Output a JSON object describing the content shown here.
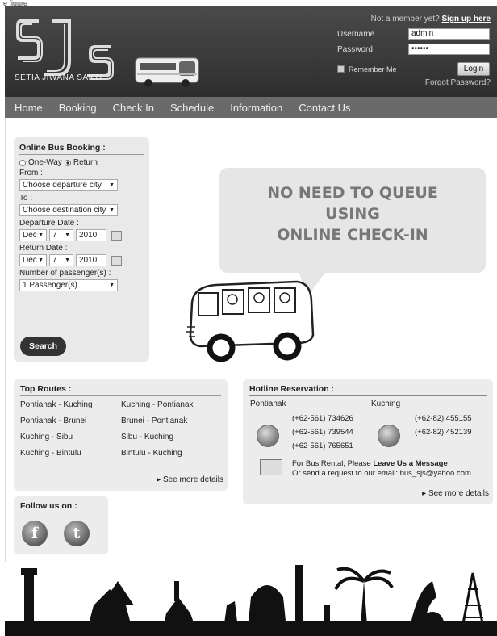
{
  "top_caption": "e figure",
  "brand": {
    "logo_letters": "SJS",
    "name": "SETIA JIWANA SAKTI"
  },
  "login": {
    "prompt": "Not a member yet?",
    "signup": "Sign up here",
    "username_label": "Username",
    "username_value": "admin",
    "password_label": "Password",
    "password_value": "••••••",
    "remember": "Remember Me",
    "button": "Login",
    "forgot": "Forgot Password?"
  },
  "nav": [
    "Home",
    "Booking",
    "Check In",
    "Schedule",
    "Information",
    "Contact Us"
  ],
  "booking": {
    "title": "Online Bus Booking :",
    "oneway": "One-Way",
    "return": "Return",
    "selected_trip": "Return",
    "from_label": "From :",
    "from_value": "Choose departure city",
    "to_label": "To :",
    "to_value": "Choose destination city",
    "dep_label": "Departure Date :",
    "dep_month": "Dec",
    "dep_day": "7",
    "dep_year": "2010",
    "ret_label": "Return Date :",
    "ret_month": "Dec",
    "ret_day": "7",
    "ret_year": "2010",
    "pax_label": "Number of passenger(s) :",
    "pax_value": "1 Passenger(s)",
    "search": "Search"
  },
  "promo": {
    "line1": "NO NEED TO QUEUE",
    "line2": "USING",
    "line3": "ONLINE CHECK-IN"
  },
  "routes": {
    "title": "Top Routes :",
    "items": [
      "Pontianak - Kuching",
      "Kuching - Pontianak",
      "Pontianak - Brunei",
      "Brunei - Pontianak",
      "Kuching - Sibu",
      "Sibu - Kuching",
      "Kuching - Bintulu",
      "Bintulu - Kuching"
    ],
    "more": "See more details"
  },
  "hotline": {
    "title": "Hotline Reservation :",
    "city1": "Pontianak",
    "city1_phones": [
      "(+62-561) 734626",
      "(+62-561) 739544",
      "(+62-561) 765651"
    ],
    "city2": "Kuching",
    "city2_phones": [
      "(+62-82) 455155",
      "(+62-82) 452139"
    ],
    "rental_prefix": "For Bus Rental, Please ",
    "rental_link": "Leave Us a Message",
    "email_line": "Or send a request to our email: bus_sjs@yahoo.com",
    "more": "See more details"
  },
  "follow": {
    "title": "Follow us on :",
    "facebook": "f",
    "twitter": "t"
  }
}
